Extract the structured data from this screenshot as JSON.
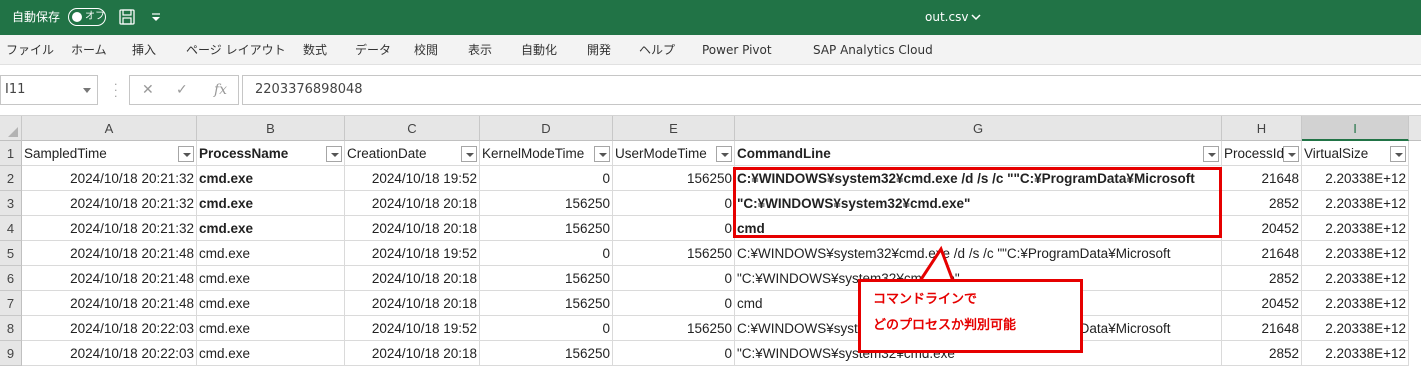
{
  "titlebar": {
    "autosave_label": "自動保存",
    "toggle_label": "オフ",
    "filename": "out.csv",
    "bg_color": "#217346"
  },
  "ribbon": {
    "tabs": [
      "ファイル",
      "ホーム",
      "挿入",
      "ページ レイアウト",
      "数式",
      "データ",
      "校閲",
      "表示",
      "自動化",
      "開発",
      "ヘルプ",
      "Power Pivot",
      "SAP Analytics Cloud"
    ]
  },
  "formula_bar": {
    "name_box": "I11",
    "formula": "2203376898048",
    "icons": [
      "close-icon",
      "check-icon",
      "fx-icon"
    ]
  },
  "sheet": {
    "column_letters": [
      "A",
      "B",
      "C",
      "D",
      "E",
      "G",
      "H",
      "I"
    ],
    "selected_column": "I",
    "headers": [
      "SampledTime",
      "ProcessName",
      "CreationDate",
      "KernelModeTime",
      "UserModeTime",
      "CommandLine",
      "ProcessId",
      "VirtualSize"
    ],
    "rows": [
      {
        "num": "2",
        "bold": true,
        "cells": [
          "2024/10/18 20:21:32",
          "cmd.exe",
          "2024/10/18 19:52",
          "0",
          "156250",
          "C:¥WINDOWS¥system32¥cmd.exe /d /s /c \"\"C:¥ProgramData¥Microsoft",
          "21648",
          "2.20338E+12"
        ]
      },
      {
        "num": "3",
        "bold": true,
        "cells": [
          "2024/10/18 20:21:32",
          "cmd.exe",
          "2024/10/18 20:18",
          "156250",
          "0",
          "\"C:¥WINDOWS¥system32¥cmd.exe\"",
          "2852",
          "2.20338E+12"
        ]
      },
      {
        "num": "4",
        "bold": true,
        "cells": [
          "2024/10/18 20:21:32",
          "cmd.exe",
          "2024/10/18 20:18",
          "156250",
          "0",
          "cmd",
          "20452",
          "2.20338E+12"
        ]
      },
      {
        "num": "5",
        "bold": false,
        "cells": [
          "2024/10/18 20:21:48",
          "cmd.exe",
          "2024/10/18 19:52",
          "0",
          "156250",
          "C:¥WINDOWS¥system32¥cmd.exe /d /s /c \"\"C:¥ProgramData¥Microsoft",
          "21648",
          "2.20338E+12"
        ]
      },
      {
        "num": "6",
        "bold": false,
        "cells": [
          "2024/10/18 20:21:48",
          "cmd.exe",
          "2024/10/18 20:18",
          "156250",
          "0",
          "\"C:¥WINDOWS¥system32¥cmd.exe\"",
          "2852",
          "2.20338E+12"
        ]
      },
      {
        "num": "7",
        "bold": false,
        "cells": [
          "2024/10/18 20:21:48",
          "cmd.exe",
          "2024/10/18 20:18",
          "156250",
          "0",
          "cmd",
          "20452",
          "2.20338E+12"
        ]
      },
      {
        "num": "8",
        "bold": false,
        "cells": [
          "2024/10/18 20:22:03",
          "cmd.exe",
          "2024/10/18 19:52",
          "0",
          "156250",
          "C:¥WINDOWS¥system32¥cmd.exe /d /s /c \"\"C:¥ProgramData¥Microsoft",
          "21648",
          "2.20338E+12"
        ]
      },
      {
        "num": "9",
        "bold": false,
        "cells": [
          "2024/10/18 20:22:03",
          "cmd.exe",
          "2024/10/18 20:18",
          "156250",
          "0",
          "\"C:¥WINDOWS¥system32¥cmd.exe\"",
          "2852",
          "2.20338E+12"
        ]
      }
    ]
  },
  "annotation": {
    "line1": "コマンドラインで",
    "line2": "どのプロセスか判別可能",
    "color": "#e60000"
  }
}
